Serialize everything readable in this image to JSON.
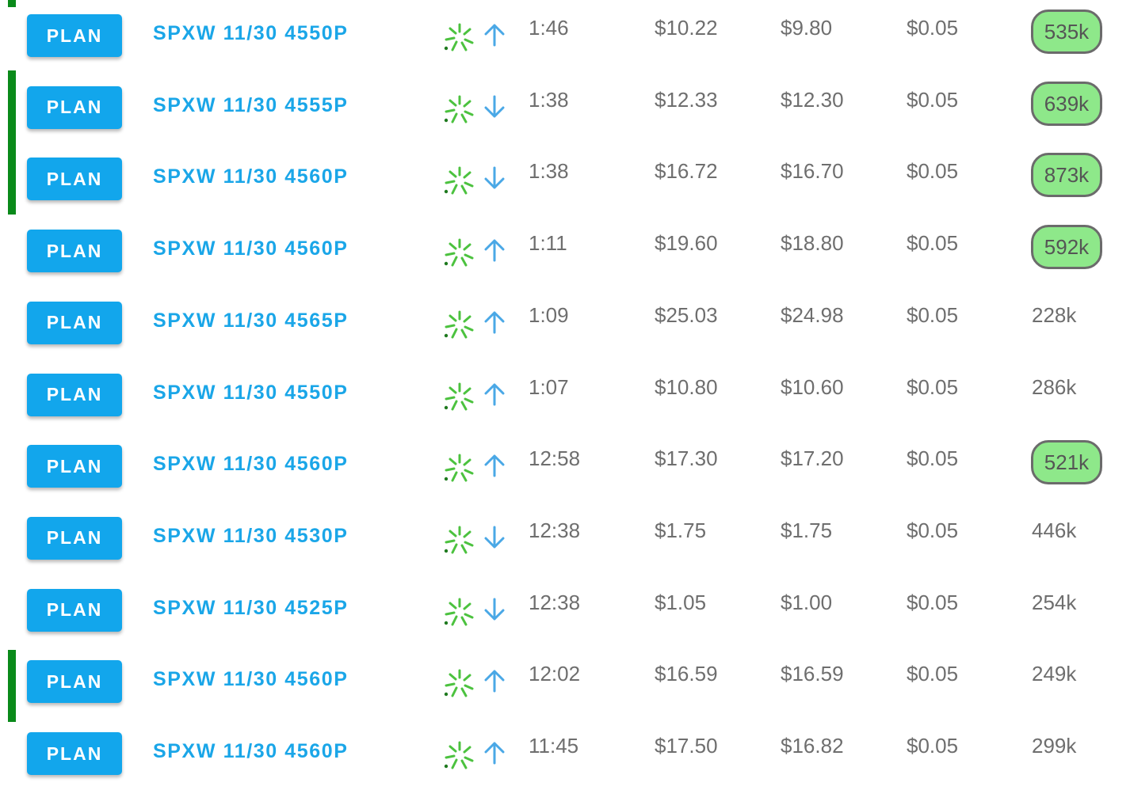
{
  "colors": {
    "button": "#12a6ec",
    "symbol": "#1aa6e8",
    "marker": "#0a8a1a",
    "highlight": "#8ee88a",
    "sweep_icon": "#4cc23f",
    "arrow": "#4aa8e6"
  },
  "rows": [
    {
      "button": "PLAN",
      "symbol": "SPXW 11/30 4550P",
      "icon": "sweep-burst-icon",
      "direction": "up",
      "time": "1:46",
      "price": "$10.22",
      "bid": "$9.80",
      "ask": "$0.05",
      "volume": "535k",
      "highlighted": true,
      "marker": "top"
    },
    {
      "button": "PLAN",
      "symbol": "SPXW 11/30 4555P",
      "icon": "sweep-burst-icon",
      "direction": "down",
      "time": "1:38",
      "price": "$12.33",
      "bid": "$12.30",
      "ask": "$0.05",
      "volume": "639k",
      "highlighted": true,
      "marker": "start"
    },
    {
      "button": "PLAN",
      "symbol": "SPXW 11/30 4560P",
      "icon": "sweep-burst-icon",
      "direction": "down",
      "time": "1:38",
      "price": "$16.72",
      "bid": "$16.70",
      "ask": "$0.05",
      "volume": "873k",
      "highlighted": true,
      "marker": "end"
    },
    {
      "button": "PLAN",
      "symbol": "SPXW 11/30 4560P",
      "icon": "sweep-burst-icon",
      "direction": "up",
      "time": "1:11",
      "price": "$19.60",
      "bid": "$18.80",
      "ask": "$0.05",
      "volume": "592k",
      "highlighted": true,
      "marker": "none"
    },
    {
      "button": "PLAN",
      "symbol": "SPXW 11/30 4565P",
      "icon": "sweep-burst-icon",
      "direction": "up",
      "time": "1:09",
      "price": "$25.03",
      "bid": "$24.98",
      "ask": "$0.05",
      "volume": "228k",
      "highlighted": false,
      "marker": "none"
    },
    {
      "button": "PLAN",
      "symbol": "SPXW 11/30 4550P",
      "icon": "sweep-burst-icon",
      "direction": "up",
      "time": "1:07",
      "price": "$10.80",
      "bid": "$10.60",
      "ask": "$0.05",
      "volume": "286k",
      "highlighted": false,
      "marker": "none"
    },
    {
      "button": "PLAN",
      "symbol": "SPXW 11/30 4560P",
      "icon": "sweep-burst-icon",
      "direction": "up",
      "time": "12:58",
      "price": "$17.30",
      "bid": "$17.20",
      "ask": "$0.05",
      "volume": "521k",
      "highlighted": true,
      "marker": "none"
    },
    {
      "button": "PLAN",
      "symbol": "SPXW 11/30 4530P",
      "icon": "sweep-burst-icon",
      "direction": "down",
      "time": "12:38",
      "price": "$1.75",
      "bid": "$1.75",
      "ask": "$0.05",
      "volume": "446k",
      "highlighted": false,
      "marker": "none"
    },
    {
      "button": "PLAN",
      "symbol": "SPXW 11/30 4525P",
      "icon": "sweep-burst-icon",
      "direction": "down",
      "time": "12:38",
      "price": "$1.05",
      "bid": "$1.00",
      "ask": "$0.05",
      "volume": "254k",
      "highlighted": false,
      "marker": "none"
    },
    {
      "button": "PLAN",
      "symbol": "SPXW 11/30 4560P",
      "icon": "sweep-burst-icon",
      "direction": "up",
      "time": "12:02",
      "price": "$16.59",
      "bid": "$16.59",
      "ask": "$0.05",
      "volume": "249k",
      "highlighted": false,
      "marker": "single"
    },
    {
      "button": "PLAN",
      "symbol": "SPXW 11/30 4560P",
      "icon": "sweep-burst-icon",
      "direction": "up",
      "time": "11:45",
      "price": "$17.50",
      "bid": "$16.82",
      "ask": "$0.05",
      "volume": "299k",
      "highlighted": false,
      "marker": "none"
    }
  ]
}
